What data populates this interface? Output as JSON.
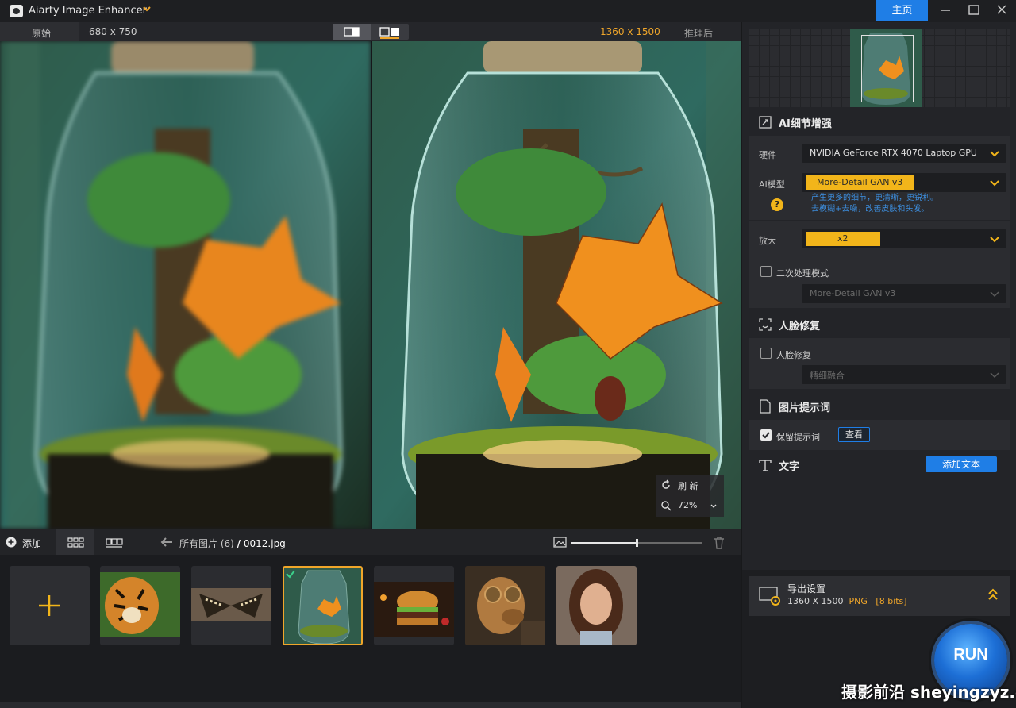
{
  "app": {
    "title": "Aiarty Image Enhancer",
    "home_label": "主页"
  },
  "preview": {
    "original_label": "原始",
    "original_size": "680 x 750",
    "result_size": "1360 x 1500",
    "result_label": "推理后",
    "refresh_label": "刷 新",
    "zoom_level": "72%"
  },
  "toolbar": {
    "add_label": "添加",
    "breadcrumb_all": "所有图片 (6)",
    "breadcrumb_sep": "/",
    "breadcrumb_file": "0012.jpg",
    "thumb_size_level": 0.5
  },
  "thumbnails": [
    {
      "icon": "tiger-image"
    },
    {
      "icon": "butterfly-image"
    },
    {
      "icon": "jar-image",
      "selected": true
    },
    {
      "icon": "burger-image"
    },
    {
      "icon": "dog-image"
    },
    {
      "icon": "portrait-image"
    }
  ],
  "panel": {
    "detail_title": "AI细节增强",
    "hardware_label": "硬件",
    "hardware_value": "NVIDIA GeForce RTX 4070 Laptop GPU",
    "model_label": "AI模型",
    "model_value": "More-Detail GAN  v3",
    "model_desc_1": "产生更多的细节，更清晰，更锐利。",
    "model_desc_2": "去模糊+去噪，改善皮肤和头发。",
    "scale_label": "放大",
    "scale_value": "x2",
    "second_pass_label": "二次处理模式",
    "second_pass_model": "More-Detail GAN  v3",
    "face_title": "人脸修复",
    "face_checkbox_label": "人脸修复",
    "face_mode": "精细融合",
    "prompt_title": "图片提示词",
    "keep_prompt_label": "保留提示词",
    "view_label": "查看",
    "text_title": "文字",
    "add_text_label": "添加文本"
  },
  "export": {
    "title": "导出设置",
    "size": "1360 X 1500",
    "format": "PNG",
    "bits": "[8 bits]",
    "run_label": "RUN"
  },
  "watermark": "摄影前沿 sheyingzyz.com",
  "colors": {
    "accent_blue": "#1f7ee6",
    "accent_orange": "#f0a62a",
    "accent_yellow": "#f2b51a"
  }
}
